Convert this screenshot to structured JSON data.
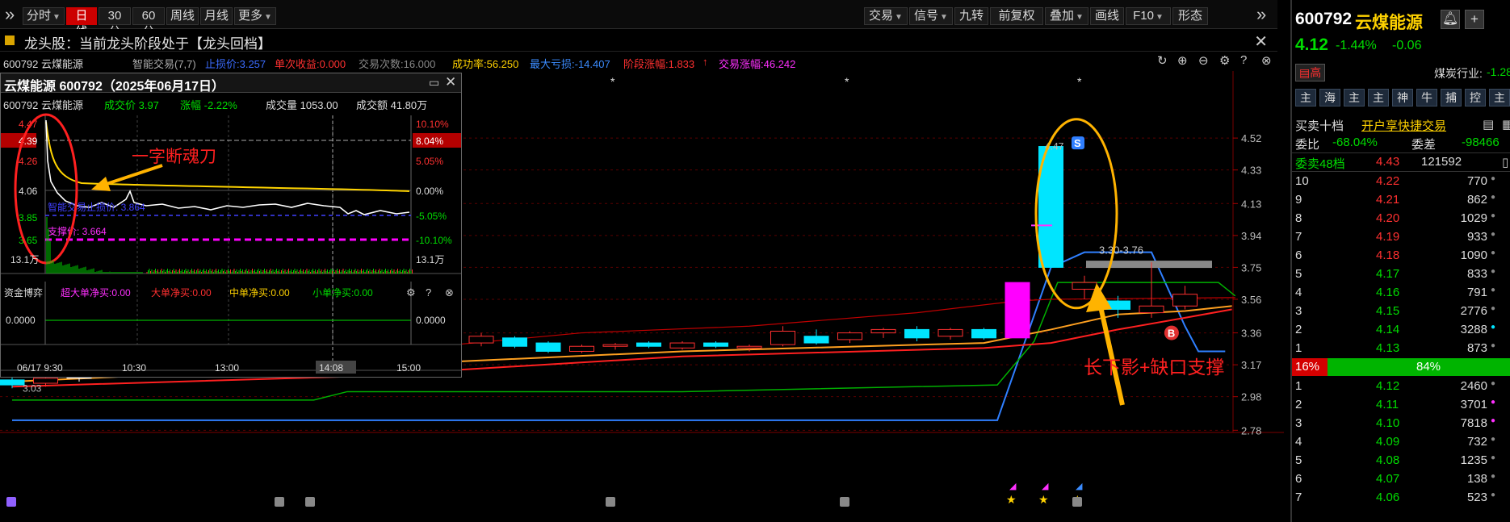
{
  "toolbar": {
    "left_items": [
      {
        "label": "分时",
        "caret": true
      },
      {
        "label": "日线",
        "caret": false,
        "active": true
      },
      {
        "label": "30分",
        "caret": false
      },
      {
        "label": "60分",
        "caret": false
      },
      {
        "label": "周线",
        "caret": false
      },
      {
        "label": "月线",
        "caret": false
      },
      {
        "label": "更多",
        "caret": true
      }
    ],
    "right_items": [
      {
        "label": "交易",
        "caret": true
      },
      {
        "label": "信号",
        "caret": true
      },
      {
        "label": "九转",
        "caret": false
      },
      {
        "label": "前复权",
        "caret": true
      },
      {
        "label": "叠加",
        "caret": true
      },
      {
        "label": "画线",
        "caret": false
      },
      {
        "label": "F10",
        "caret": true
      },
      {
        "label": "形态",
        "caret": false
      }
    ]
  },
  "banner": {
    "text": "龙头股：当前龙头阶段处于【龙头回档】"
  },
  "infoline": {
    "code_name": "600792 云煤能源",
    "indicator": "智能交易(7,7)",
    "stop_loss": "止损价:3.257",
    "single_gain": "单次收益:0.000",
    "trade_count": "交易次数:16.000",
    "success_rate": "成功率:56.250",
    "max_loss": "最大亏损:-14.407",
    "stage_gain": "阶段涨幅:1.833",
    "trade_gain": "交易涨幅:46.242"
  },
  "popup": {
    "title": "云煤能源 600792（2025年06月17日）",
    "code": "600792 云煤能源",
    "price": "成交价 3.97",
    "change": "涨幅 -2.22%",
    "volume": "成交量 1053.00",
    "amount": "成交额 41.80万",
    "y_left": [
      "4.47",
      "4.39",
      "4.26",
      "4.06",
      "3.85",
      "3.65"
    ],
    "y_right": [
      "10.10%",
      "8.04%",
      "5.05%",
      "0.00%",
      "-5.05%",
      "-10.10%"
    ],
    "stop_label": "智能交易止损价: 3.864",
    "support_label": "支撑价: 3.664",
    "vol_label": "13.1万",
    "fund_title": "资金博弈",
    "fund_items": [
      "超大单净买:0.00",
      "大单净买:0.00",
      "中单净买:0.00",
      "小单净买:0.00"
    ],
    "fund_value": "0.0000",
    "times": [
      "06/17 9:30",
      "10:30",
      "13:00",
      "14:08",
      "15:00"
    ],
    "annotation": "一字断魂刀"
  },
  "main_chart": {
    "y_axis": [
      "4.52",
      "4.33",
      "4.13",
      "3.94",
      "3.75",
      "3.56",
      "3.36",
      "3.17",
      "2.98",
      "2.78"
    ],
    "low_label": "3.03",
    "high_label": "4.47",
    "range_label": "3.30-3.76",
    "annotation": "长下影+缺口支撑",
    "signal_S": "S",
    "signal_B": "B"
  },
  "chart_data": {
    "type": "candlestick",
    "ylim": [
      2.7,
      4.6
    ],
    "candles": [
      {
        "o": 3.08,
        "h": 3.1,
        "l": 3.03,
        "c": 3.05,
        "color": "cyan"
      },
      {
        "o": 3.06,
        "h": 3.1,
        "l": 3.04,
        "c": 3.09,
        "color": "red"
      },
      {
        "o": 3.1,
        "h": 3.13,
        "l": 3.07,
        "c": 3.1,
        "color": "white"
      },
      {
        "o": 3.13,
        "h": 3.2,
        "l": 3.12,
        "c": 3.18,
        "color": "red"
      },
      {
        "o": 3.2,
        "h": 3.22,
        "l": 3.18,
        "c": 3.21,
        "color": "red"
      },
      {
        "o": 3.21,
        "h": 3.23,
        "l": 3.19,
        "c": 3.2,
        "color": "cyan"
      },
      {
        "o": 3.2,
        "h": 3.22,
        "l": 3.18,
        "c": 3.21,
        "color": "white"
      },
      {
        "o": 3.22,
        "h": 3.24,
        "l": 3.17,
        "c": 3.18,
        "color": "cyan"
      },
      {
        "o": 3.19,
        "h": 3.22,
        "l": 3.17,
        "c": 3.21,
        "color": "red"
      },
      {
        "o": 3.2,
        "h": 3.25,
        "l": 3.19,
        "c": 3.24,
        "color": "red"
      },
      {
        "o": 3.25,
        "h": 3.28,
        "l": 3.23,
        "c": 3.26,
        "color": "red"
      },
      {
        "o": 3.27,
        "h": 3.3,
        "l": 3.25,
        "c": 3.28,
        "color": "red"
      },
      {
        "o": 3.28,
        "h": 3.3,
        "l": 3.26,
        "c": 3.27,
        "color": "red"
      },
      {
        "o": 3.29,
        "h": 3.31,
        "l": 3.27,
        "c": 3.28,
        "color": "red"
      },
      {
        "o": 3.3,
        "h": 3.36,
        "l": 3.28,
        "c": 3.34,
        "color": "red"
      },
      {
        "o": 3.33,
        "h": 3.34,
        "l": 3.27,
        "c": 3.28,
        "color": "cyan"
      },
      {
        "o": 3.3,
        "h": 3.31,
        "l": 3.24,
        "c": 3.25,
        "color": "cyan"
      },
      {
        "o": 3.25,
        "h": 3.29,
        "l": 3.24,
        "c": 3.28,
        "color": "red"
      },
      {
        "o": 3.28,
        "h": 3.3,
        "l": 3.26,
        "c": 3.29,
        "color": "red"
      },
      {
        "o": 3.3,
        "h": 3.31,
        "l": 3.27,
        "c": 3.28,
        "color": "cyan"
      },
      {
        "o": 3.27,
        "h": 3.31,
        "l": 3.26,
        "c": 3.3,
        "color": "red"
      },
      {
        "o": 3.3,
        "h": 3.31,
        "l": 3.27,
        "c": 3.28,
        "color": "cyan"
      },
      {
        "o": 3.27,
        "h": 3.29,
        "l": 3.25,
        "c": 3.28,
        "color": "red"
      },
      {
        "o": 3.29,
        "h": 3.4,
        "l": 3.28,
        "c": 3.37,
        "color": "red"
      },
      {
        "o": 3.34,
        "h": 3.38,
        "l": 3.29,
        "c": 3.3,
        "color": "cyan"
      },
      {
        "o": 3.32,
        "h": 3.37,
        "l": 3.3,
        "c": 3.36,
        "color": "red"
      },
      {
        "o": 3.36,
        "h": 3.39,
        "l": 3.33,
        "c": 3.38,
        "color": "red"
      },
      {
        "o": 3.38,
        "h": 3.4,
        "l": 3.31,
        "c": 3.33,
        "color": "cyan"
      },
      {
        "o": 3.34,
        "h": 3.39,
        "l": 3.32,
        "c": 3.38,
        "color": "red"
      },
      {
        "o": 3.38,
        "h": 3.39,
        "l": 3.32,
        "c": 3.33,
        "color": "cyan"
      },
      {
        "o": 3.33,
        "h": 3.66,
        "l": 3.33,
        "c": 3.66,
        "color": "magenta"
      },
      {
        "o": 3.75,
        "h": 4.47,
        "l": 3.75,
        "c": 4.47,
        "color": "cyan"
      },
      {
        "o": 3.66,
        "h": 3.7,
        "l": 3.56,
        "c": 3.62,
        "color": "red"
      },
      {
        "o": 3.55,
        "h": 3.58,
        "l": 3.45,
        "c": 3.5,
        "color": "cyan"
      },
      {
        "o": 3.48,
        "h": 3.78,
        "l": 3.45,
        "c": 3.52,
        "color": "red"
      },
      {
        "o": 3.52,
        "h": 3.64,
        "l": 3.5,
        "c": 3.59,
        "color": "red"
      }
    ],
    "right_axis_labels": [
      "4.52",
      "4.33",
      "4.13",
      "3.94",
      "3.75",
      "3.56",
      "3.36",
      "3.17",
      "2.98",
      "2.78"
    ]
  },
  "right_panel": {
    "code": "600792",
    "name": "云煤能源",
    "price": "4.12",
    "pct": "-1.44%",
    "chg": "-0.06",
    "tag_high": "高",
    "industry": "煤炭行业:",
    "industry_val": "-1.28",
    "buttons": [
      "主",
      "海",
      "主",
      "主",
      "神",
      "牛",
      "捕",
      "控",
      "主"
    ],
    "ten_levels": "买卖十档",
    "quick_trade": "开户享快捷交易",
    "weibi_label": "委比",
    "weibi_val": "-68.04%",
    "weicha_label": "委差",
    "weicha_val": "-98466",
    "sell_header": "委卖48档",
    "sell_header_price": "4.43",
    "sell_header_vol": "121592",
    "sells": [
      {
        "lvl": "10",
        "price": "4.22",
        "vol": "770"
      },
      {
        "lvl": "9",
        "price": "4.21",
        "vol": "862"
      },
      {
        "lvl": "8",
        "price": "4.20",
        "vol": "1029"
      },
      {
        "lvl": "7",
        "price": "4.19",
        "vol": "933"
      },
      {
        "lvl": "6",
        "price": "4.18",
        "vol": "1090"
      },
      {
        "lvl": "5",
        "price": "4.17",
        "vol": "833"
      },
      {
        "lvl": "4",
        "price": "4.16",
        "vol": "791"
      },
      {
        "lvl": "3",
        "price": "4.15",
        "vol": "2776"
      },
      {
        "lvl": "2",
        "price": "4.14",
        "vol": "3288"
      },
      {
        "lvl": "1",
        "price": "4.13",
        "vol": "873"
      }
    ],
    "ratio_sell": "16%",
    "ratio_buy": "84%",
    "buys": [
      {
        "lvl": "1",
        "price": "4.12",
        "vol": "2460"
      },
      {
        "lvl": "2",
        "price": "4.11",
        "vol": "3701"
      },
      {
        "lvl": "3",
        "price": "4.10",
        "vol": "7818"
      },
      {
        "lvl": "4",
        "price": "4.09",
        "vol": "732"
      },
      {
        "lvl": "5",
        "price": "4.08",
        "vol": "1235"
      },
      {
        "lvl": "6",
        "price": "4.07",
        "vol": "138"
      },
      {
        "lvl": "7",
        "price": "4.06",
        "vol": "523"
      }
    ]
  },
  "colors": {
    "up": "#ff3030",
    "down": "#00e5ff",
    "accent": "#cc0000",
    "price_green": "#00dd00"
  }
}
